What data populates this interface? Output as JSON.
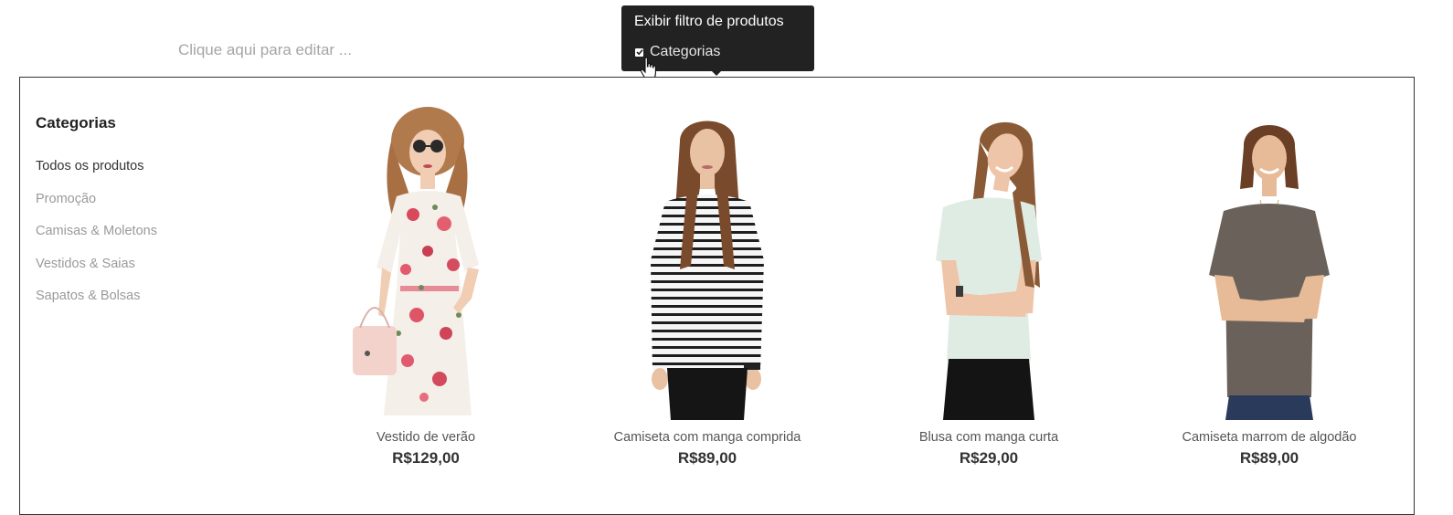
{
  "editor": {
    "placeholder": "Clique aqui para editar ..."
  },
  "tooltip": {
    "title": "Exibir filtro de produtos",
    "option_label": "Categorias",
    "option_checked": true
  },
  "sidebar": {
    "title": "Categorias",
    "items": [
      {
        "label": "Todos os produtos",
        "active": true
      },
      {
        "label": "Promoção",
        "active": false
      },
      {
        "label": "Camisas & Moletons",
        "active": false
      },
      {
        "label": "Vestidos & Saias",
        "active": false
      },
      {
        "label": "Sapatos & Bolsas",
        "active": false
      }
    ]
  },
  "products": [
    {
      "name": "Vestido de verão",
      "price": "R$129,00"
    },
    {
      "name": "Camiseta com manga comprida",
      "price": "R$89,00"
    },
    {
      "name": "Blusa com manga curta",
      "price": "R$29,00"
    },
    {
      "name": "Camiseta marrom de algodão",
      "price": "R$89,00"
    }
  ]
}
